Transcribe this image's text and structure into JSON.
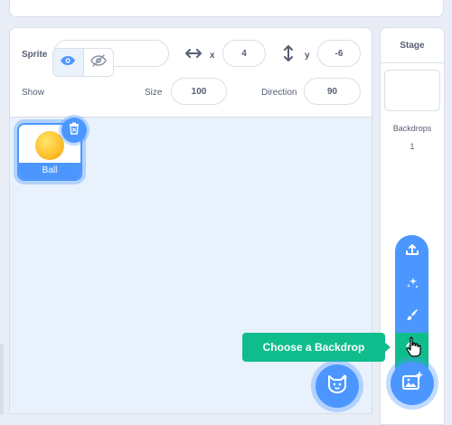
{
  "sprite_info": {
    "sprite_label": "Sprite",
    "sprite_name": "Ball",
    "x_label": "x",
    "x_value": "4",
    "y_label": "y",
    "y_value": "-6",
    "show_label": "Show",
    "size_label": "Size",
    "size_value": "100",
    "direction_label": "Direction",
    "direction_value": "90"
  },
  "sprites": [
    {
      "name": "Ball",
      "selected": true
    }
  ],
  "stage": {
    "title": "Stage",
    "backdrops_label": "Backdrops",
    "backdrops_count": "1"
  },
  "backdrop_menu": {
    "tooltip": "Choose a Backdrop",
    "items": [
      "upload-icon",
      "surprise-icon",
      "paint-icon",
      "search-icon"
    ],
    "active_item": "search-icon"
  },
  "colors": {
    "accent": "#4c97ff",
    "active": "#0fbd8c",
    "text": "#575e75"
  }
}
